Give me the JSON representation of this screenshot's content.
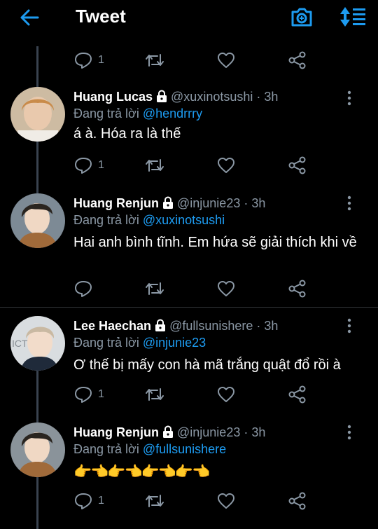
{
  "header": {
    "title": "Tweet",
    "back_icon": "arrow-left-icon",
    "camera_icon": "camera-plus-icon",
    "sort_icon": "sort-icon",
    "accent": "#1d9bf0"
  },
  "top_actions": {
    "reply_count": "1"
  },
  "tweets": [
    {
      "name": "Huang Lucas",
      "handle": "@xuxinotsushi",
      "time": "· 3h",
      "reply_prefix": "Đang trả lời ",
      "reply_to": "@hendrrry",
      "text": "á à. Hóa ra là thế",
      "reply_count": "1"
    },
    {
      "name": "Huang Renjun",
      "handle": "@injunie23",
      "time": "· 3h",
      "reply_prefix": "Đang trả lời ",
      "reply_to": "@xuxinotsushi",
      "text": "Hai anh bình tĩnh. Em hứa sẽ giải thích khi về",
      "reply_count": ""
    },
    {
      "name": "Lee Haechan",
      "handle": "@fullsunishere",
      "time": "· 3h",
      "reply_prefix": "Đang trả lời ",
      "reply_to": "@injunie23",
      "text": "Ơ thế bị mấy con hà mã trắng quật đổ rồi à",
      "reply_count": "1"
    },
    {
      "name": "Huang Renjun",
      "handle": "@injunie23",
      "time": "· 3h",
      "reply_prefix": "Đang trả lời ",
      "reply_to": "@fullsunishere",
      "text": "👉👈👉👈👉👈👉👈",
      "reply_count": "1"
    }
  ]
}
